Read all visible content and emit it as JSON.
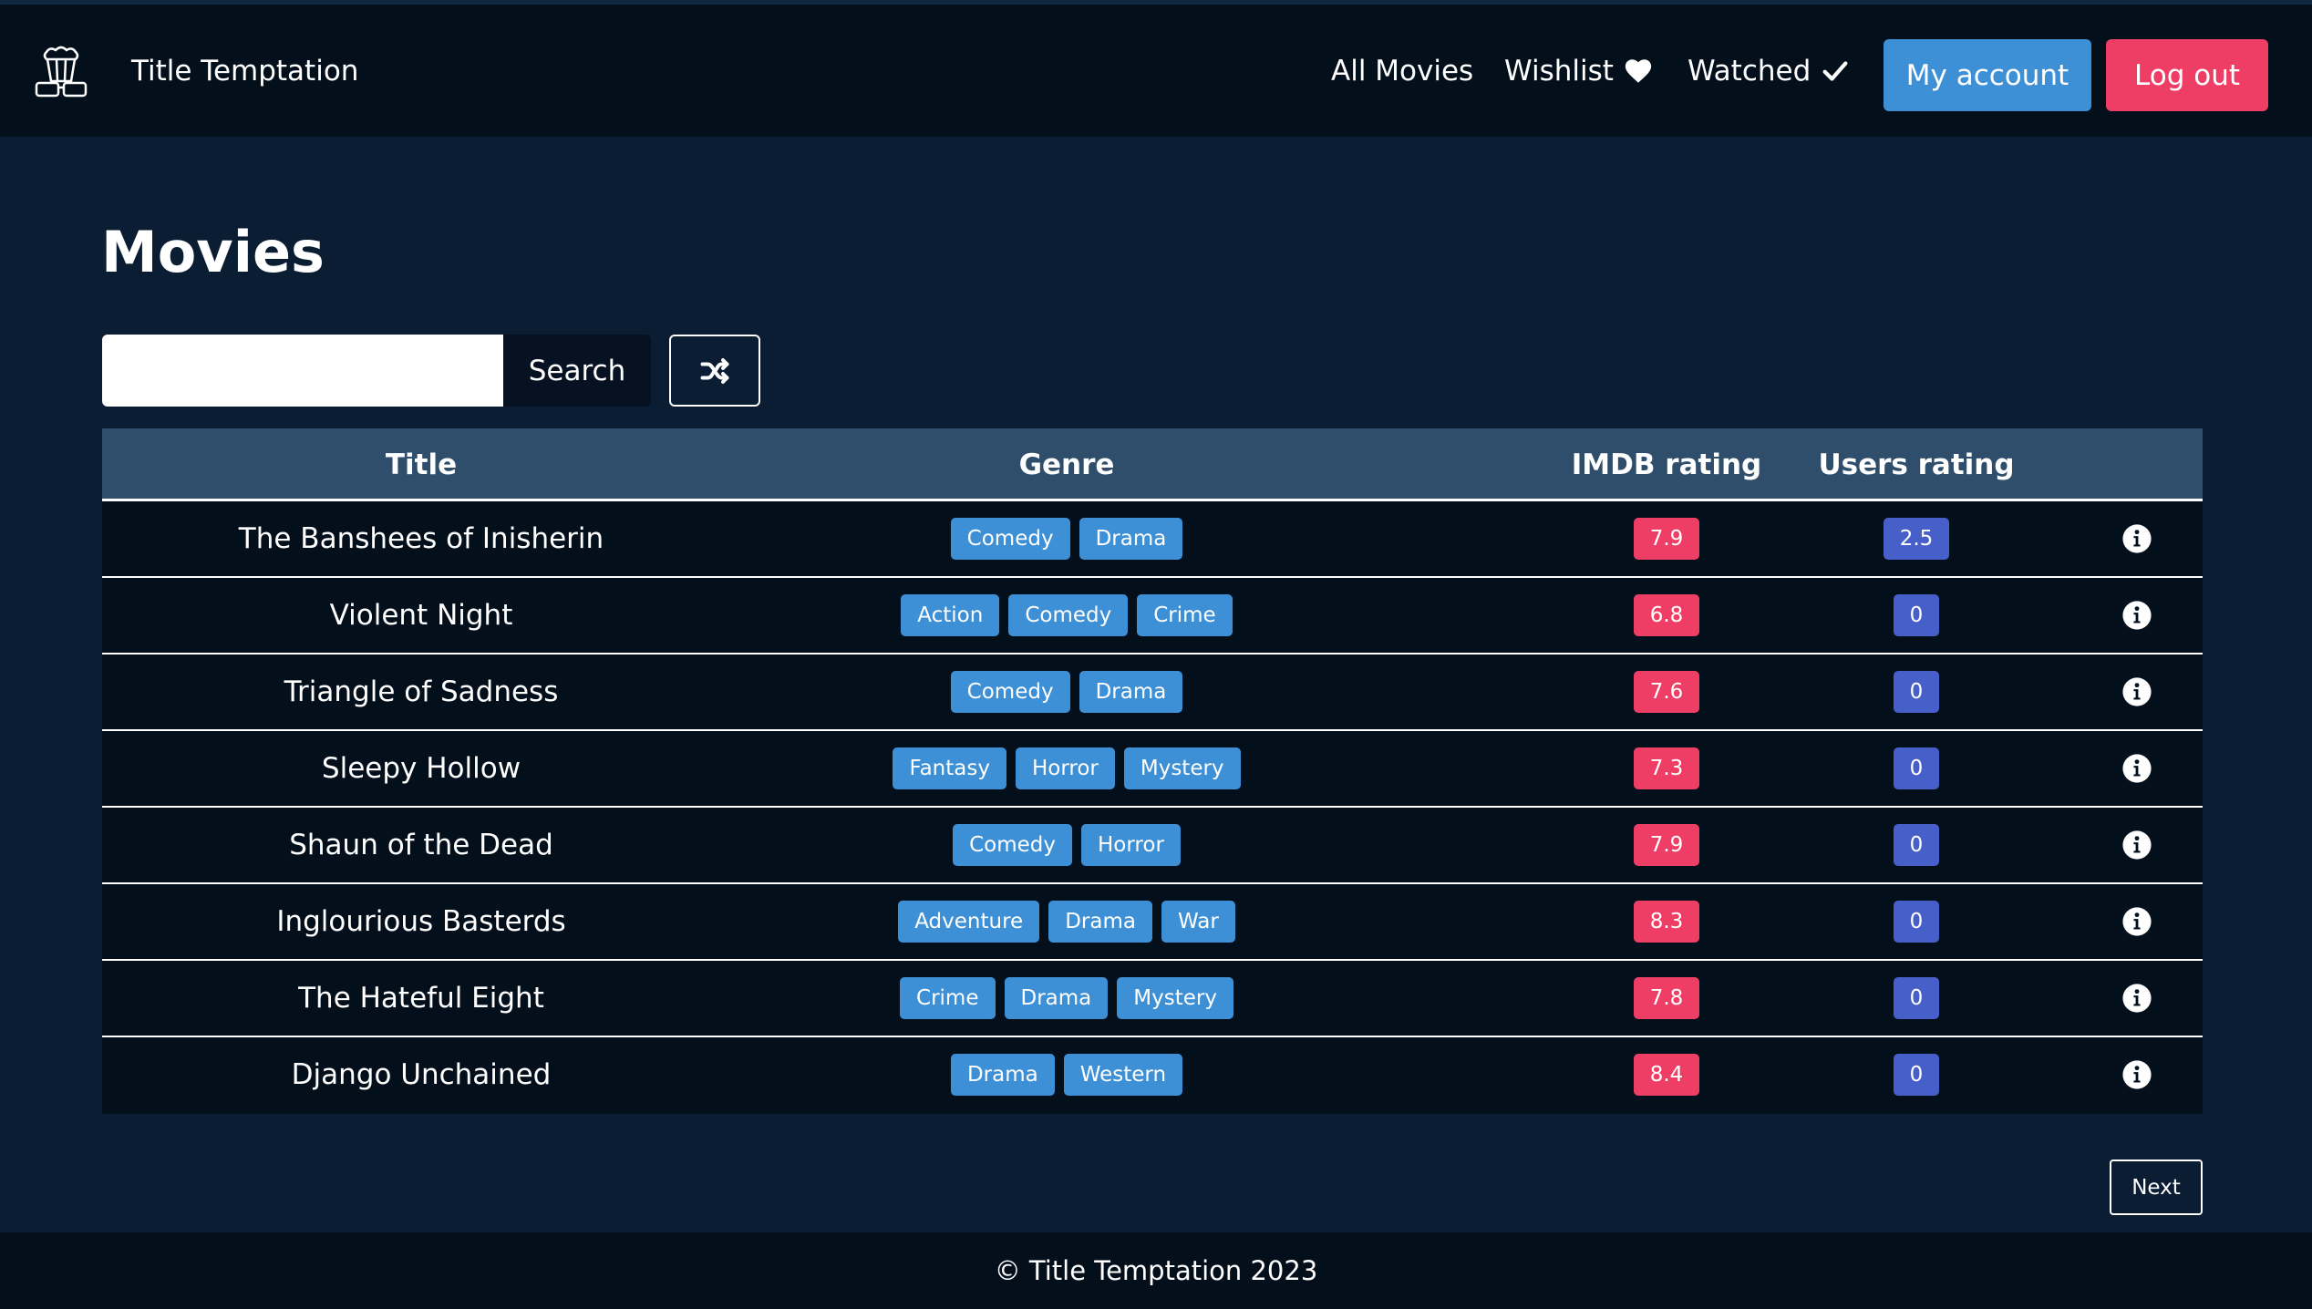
{
  "nav": {
    "brand": "Title Temptation",
    "links": [
      "All Movies",
      "Wishlist",
      "Watched"
    ],
    "account": "My account",
    "logout": "Log out"
  },
  "page": {
    "title": "Movies",
    "search_value": "",
    "search_button": "Search"
  },
  "table": {
    "headers": [
      "Title",
      "Genre",
      "IMDB rating",
      "Users rating"
    ],
    "rows": [
      {
        "title": "The Banshees of Inisherin",
        "genres": [
          "Comedy",
          "Drama"
        ],
        "imdb": "7.9",
        "users": "2.5"
      },
      {
        "title": "Violent Night",
        "genres": [
          "Action",
          "Comedy",
          "Crime"
        ],
        "imdb": "6.8",
        "users": "0"
      },
      {
        "title": "Triangle of Sadness",
        "genres": [
          "Comedy",
          "Drama"
        ],
        "imdb": "7.6",
        "users": "0"
      },
      {
        "title": "Sleepy Hollow",
        "genres": [
          "Fantasy",
          "Horror",
          "Mystery"
        ],
        "imdb": "7.3",
        "users": "0"
      },
      {
        "title": "Shaun of the Dead",
        "genres": [
          "Comedy",
          "Horror"
        ],
        "imdb": "7.9",
        "users": "0"
      },
      {
        "title": "Inglourious Basterds",
        "genres": [
          "Adventure",
          "Drama",
          "War"
        ],
        "imdb": "8.3",
        "users": "0"
      },
      {
        "title": "The Hateful Eight",
        "genres": [
          "Crime",
          "Drama",
          "Mystery"
        ],
        "imdb": "7.8",
        "users": "0"
      },
      {
        "title": "Django Unchained",
        "genres": [
          "Drama",
          "Western"
        ],
        "imdb": "8.4",
        "users": "0"
      }
    ]
  },
  "pagination": {
    "next": "Next"
  },
  "footer": {
    "text": "© Title Temptation 2023"
  },
  "colors": {
    "background": "#0a1d33",
    "navbar": "#040f1c",
    "account_button": "#3d8fd6",
    "logout_button": "#ef3e66",
    "genre_badge": "#3d8fd6",
    "imdb_badge": "#ef3e66",
    "users_badge": "#4760c9"
  },
  "icons": {
    "brand": "popcorn-3d-glasses-icon",
    "wishlist": "heart-icon",
    "watched": "check-icon",
    "shuffle": "shuffle-icon",
    "info": "info-circle-icon"
  }
}
